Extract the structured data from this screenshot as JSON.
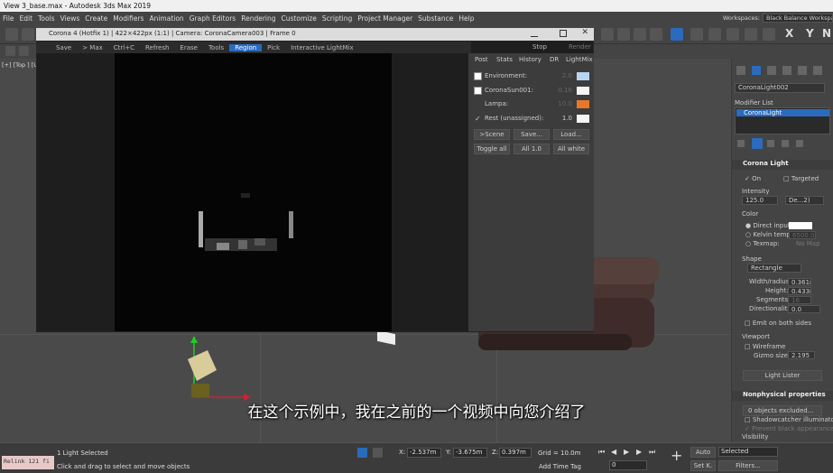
{
  "window": {
    "title": "View 3_base.max - Autodesk 3ds Max 2019"
  },
  "menu": [
    "File",
    "Edit",
    "Tools",
    "Views",
    "Create",
    "Modifiers",
    "Animation",
    "Graph Editors",
    "Rendering",
    "Customize",
    "Scripting",
    "Project Manager",
    "Substance",
    "Help"
  ],
  "workspaces": {
    "label": "Workspaces:",
    "value": "Black Balance Workspace"
  },
  "toolbar": {
    "mark_n": "N",
    "mark_x": "X",
    "mark_y": "Y"
  },
  "viewport": {
    "label": "[+] [Top ] [U"
  },
  "framebuffer": {
    "title": "Corona 4 (Hotfix 1) | 422×422px (1:1) | Camera: CoronaCamera003 | Frame 0",
    "tools": [
      "Save",
      "> Max",
      "Ctrl+C",
      "Refresh",
      "Erase",
      "Tools",
      "Region",
      "Pick",
      "Interactive LightMix"
    ],
    "stop": "Stop",
    "render": "Render",
    "tabs": [
      "Post",
      "Stats",
      "History",
      "DR",
      "LightMix"
    ],
    "lightmix": [
      {
        "name": "Environment:",
        "value": "2.0",
        "checked": false
      },
      {
        "name": "CoronaSun001:",
        "value": "0.16",
        "checked": false
      },
      {
        "name": "Lampa:",
        "value": "10.0",
        "checked": false
      },
      {
        "name": "Rest (unassigned):",
        "value": "1.0",
        "checked": true
      }
    ],
    "buttons": [
      ">Scene",
      "Save...",
      "Load...",
      "Toggle all",
      "All 1.0",
      "All white"
    ]
  },
  "panel": {
    "object_name": "CoronaLight002",
    "modifier_list": "Modifier List",
    "stack_item": "CoronaLight",
    "rollout": "Corona Light",
    "on": "On",
    "targeted": "Targeted",
    "intensity_label": "Intensity",
    "intensity": "125.0",
    "intensity_unit": "De...2)",
    "color_label": "Color",
    "direct_input": "Direct input:",
    "kelvin": "Kelvin temp:",
    "kelvin_val": "6500.0",
    "texmap": "Texmap:",
    "nomap": "No Map",
    "shape_label": "Shape",
    "shape": "Rectangle",
    "width_label": "Width/radius:",
    "width": "0.361m",
    "height_label": "Height:",
    "height": "0.433m",
    "segments_label": "Segments:",
    "segments": "16",
    "directionality_label": "Directionality:",
    "directionality": "0.0",
    "emit": "Emit on both sides",
    "viewport_label": "Viewport",
    "wireframe": "Wireframe",
    "gizmo_label": "Gizmo size:",
    "gizmo": "2.195",
    "light_lister": "Light Lister",
    "nonphys": "Nonphysical properties",
    "excluded": "0 objects excluded...",
    "shadowcatcher": "Shadowcatcher illuminator",
    "prevent": "Prevent black appearance",
    "visibility": "Visibility"
  },
  "status": {
    "relink": "Relink 121 fi",
    "selected": "1 Light Selected",
    "prompt": "Click and drag to select and move objects",
    "x": "-2.537m",
    "y": "-3.675m",
    "z": "0.397m",
    "grid": "Grid = 10.0m",
    "add_time_tag": "Add Time Tag",
    "auto": "Auto",
    "selected_dd": "Selected",
    "setk": "Set K.",
    "filters": "Filters...",
    "frame": "0"
  },
  "subtitle": "在这个示例中，我在之前的一个视频中向您介绍了",
  "colors": {
    "accent": "#2a6bbd",
    "lampa": "#e8772a",
    "env": "#b9d4f0"
  }
}
